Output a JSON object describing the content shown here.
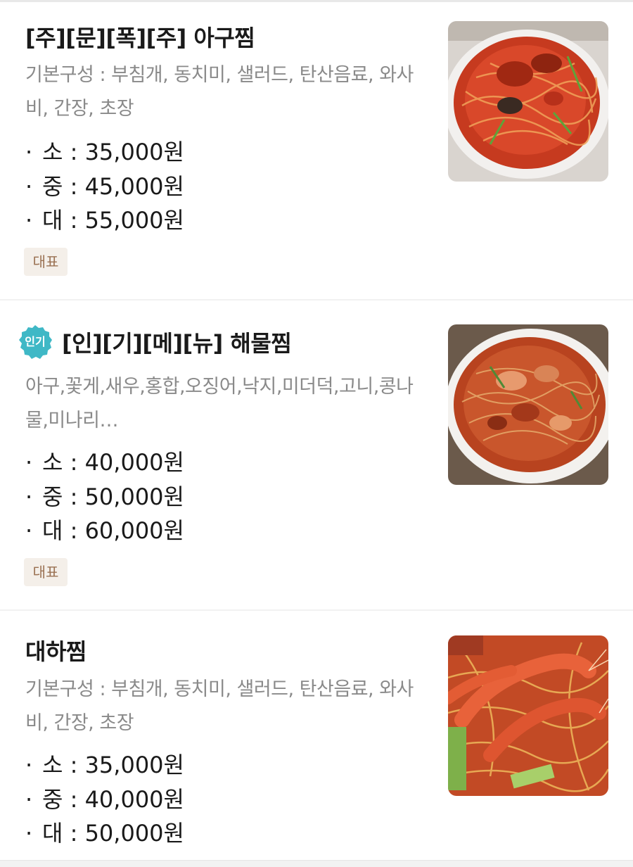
{
  "menu": {
    "items": [
      {
        "title": "[주][문][폭][주] 아구찜",
        "description": "기본구성 : 부침개, 동치미, 샐러드, 탄산음료, 와사비, 간장, 초장",
        "prices": [
          "소 : 35,000원",
          "중 : 45,000원",
          "대 : 55,000원"
        ],
        "tag": "대표",
        "image": "braised-monkfish-photo"
      },
      {
        "badge": "인기",
        "title": "[인][기][메][뉴] 해물찜",
        "description": "아구,꽃게,새우,홍합,오징어,낙지,미더덕,고니,콩나물,미나리…",
        "prices": [
          "소 : 40,000원",
          "중 : 50,000원",
          "대 : 60,000원"
        ],
        "tag": "대표",
        "image": "braised-seafood-photo"
      },
      {
        "title": "대하찜",
        "description": "기본구성 : 부침개, 동치미, 샐러드, 탄산음료, 와사비, 간장, 초장",
        "prices": [
          "소 : 35,000원",
          "중 : 40,000원",
          "대 : 50,000원"
        ],
        "image": "braised-king-prawn-photo"
      }
    ]
  },
  "colors": {
    "tag_bg": "#f4efe9",
    "tag_text": "#9a7152",
    "badge_bg": "#3fb8c6",
    "description": "#8a8a8a"
  }
}
